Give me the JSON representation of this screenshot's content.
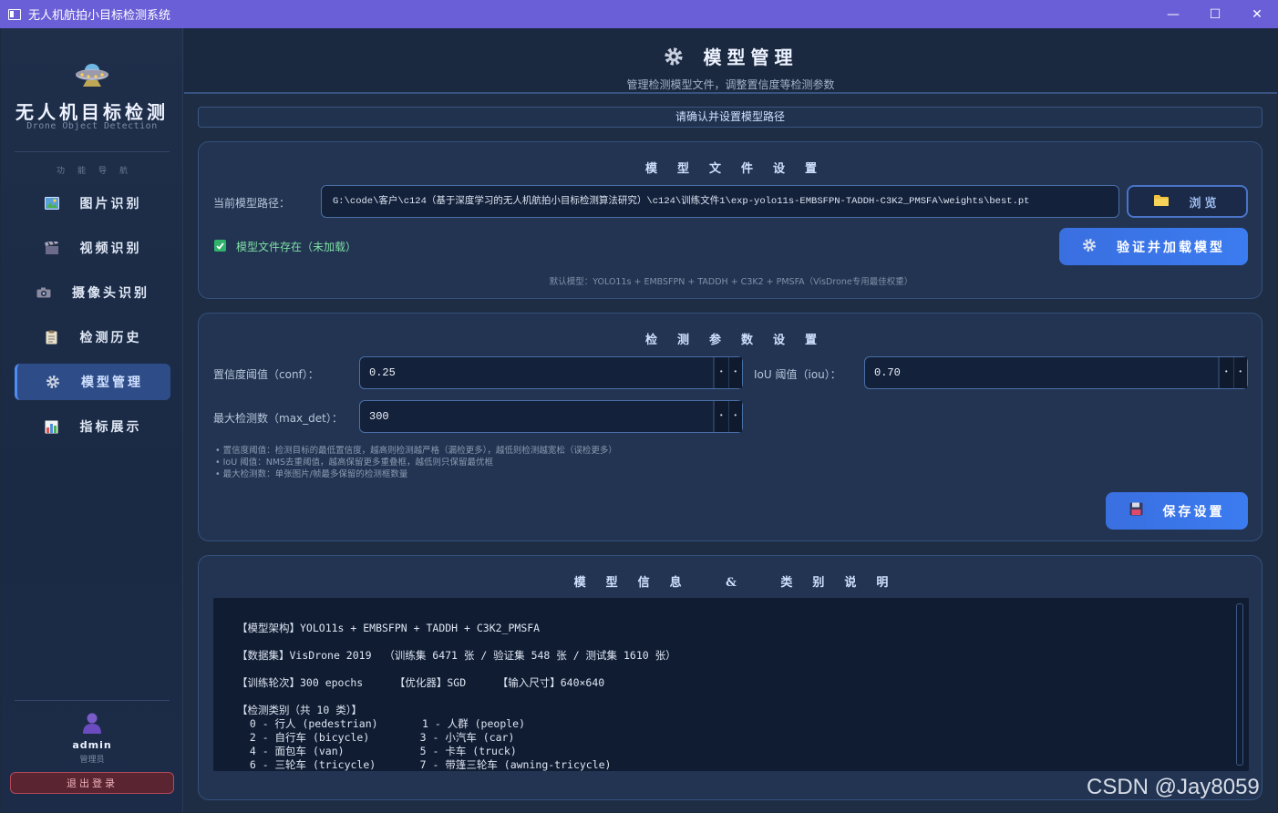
{
  "window": {
    "title": "无人机航拍小目标检测系统",
    "controls": [
      "—",
      "☐",
      "✕"
    ]
  },
  "sidebar": {
    "brand_title": "无人机目标检测",
    "brand_subtitle": "Drone Object Detection",
    "nav_caption": "功能导航",
    "items": [
      {
        "label": "图片识别",
        "icon": "image-icon",
        "active": false
      },
      {
        "label": "视频识别",
        "icon": "clapperboard-icon",
        "active": false
      },
      {
        "label": "摄像头识别",
        "icon": "camera-icon",
        "active": false
      },
      {
        "label": "检测历史",
        "icon": "clipboard-icon",
        "active": false
      },
      {
        "label": "模型管理",
        "icon": "gear-icon",
        "active": true
      },
      {
        "label": "指标展示",
        "icon": "bar-chart-icon",
        "active": false
      }
    ],
    "user": {
      "name": "admin",
      "role": "管理员"
    },
    "logout_label": "退出登录"
  },
  "header": {
    "title": "模型管理",
    "subtitle": "管理检测模型文件，调整置信度等检测参数"
  },
  "status_banner": "请确认并设置模型路径",
  "model_file": {
    "title": "模型文件设置",
    "path_label": "当前模型路径：",
    "path_value": "G:\\code\\客户\\c124（基于深度学习的无人机航拍小目标检测算法研究）\\c124\\训练文件1\\exp-yolo11s-EMBSFPN-TADDH-C3K2_PMSFA\\weights\\best.pt",
    "browse_label": "浏览",
    "status_text": "模型文件存在（未加载）",
    "load_button": "验证并加载模型",
    "default_hint": "默认模型：YOLO11s + EMBSFPN + TADDH + C3K2 + PMSFA（VisDrone专用最佳权重）"
  },
  "params": {
    "title": "检测参数设置",
    "conf_label": "置信度阈值（conf）：",
    "conf_value": "0.25",
    "iou_label": "IoU 阈值（iou）：",
    "iou_value": "0.70",
    "maxdet_label": "最大检测数（max_det）：",
    "maxdet_value": "300",
    "notes": [
      "• 置信度阈值：检测目标的最低置信度，越高则检测越严格（漏检更多），越低则检测越宽松（误检更多）",
      "• IoU 阈值：NMS去重阈值，越高保留更多重叠框，越低则只保留最优框",
      "• 最大检测数：单张图片/帧最多保留的检测框数量"
    ],
    "save_button": "保存设置"
  },
  "model_info": {
    "title": "模型信息 & 类别说明",
    "architecture": "【模型架构】YOLO11s + EMBSFPN + TADDH + C3K2_PMSFA",
    "dataset": "【数据集】VisDrone 2019  （训练集 6471 张 / 验证集 548 张 / 测试集 1610 张）",
    "training": "【训练轮次】300 epochs     【优化器】SGD     【输入尺寸】640×640",
    "classes_header": "【检测类别（共 10 类）】",
    "class_rows": [
      "  0 - 行人 (pedestrian)       1 - 人群 (people)",
      "  2 - 自行车 (bicycle)        3 - 小汽车 (car)",
      "  4 - 面包车 (van)            5 - 卡车 (truck)",
      "  6 - 三轮车 (tricycle)       7 - 带篷三轮车 (awning-tricycle)"
    ]
  },
  "watermark": "CSDN @Jay8059"
}
